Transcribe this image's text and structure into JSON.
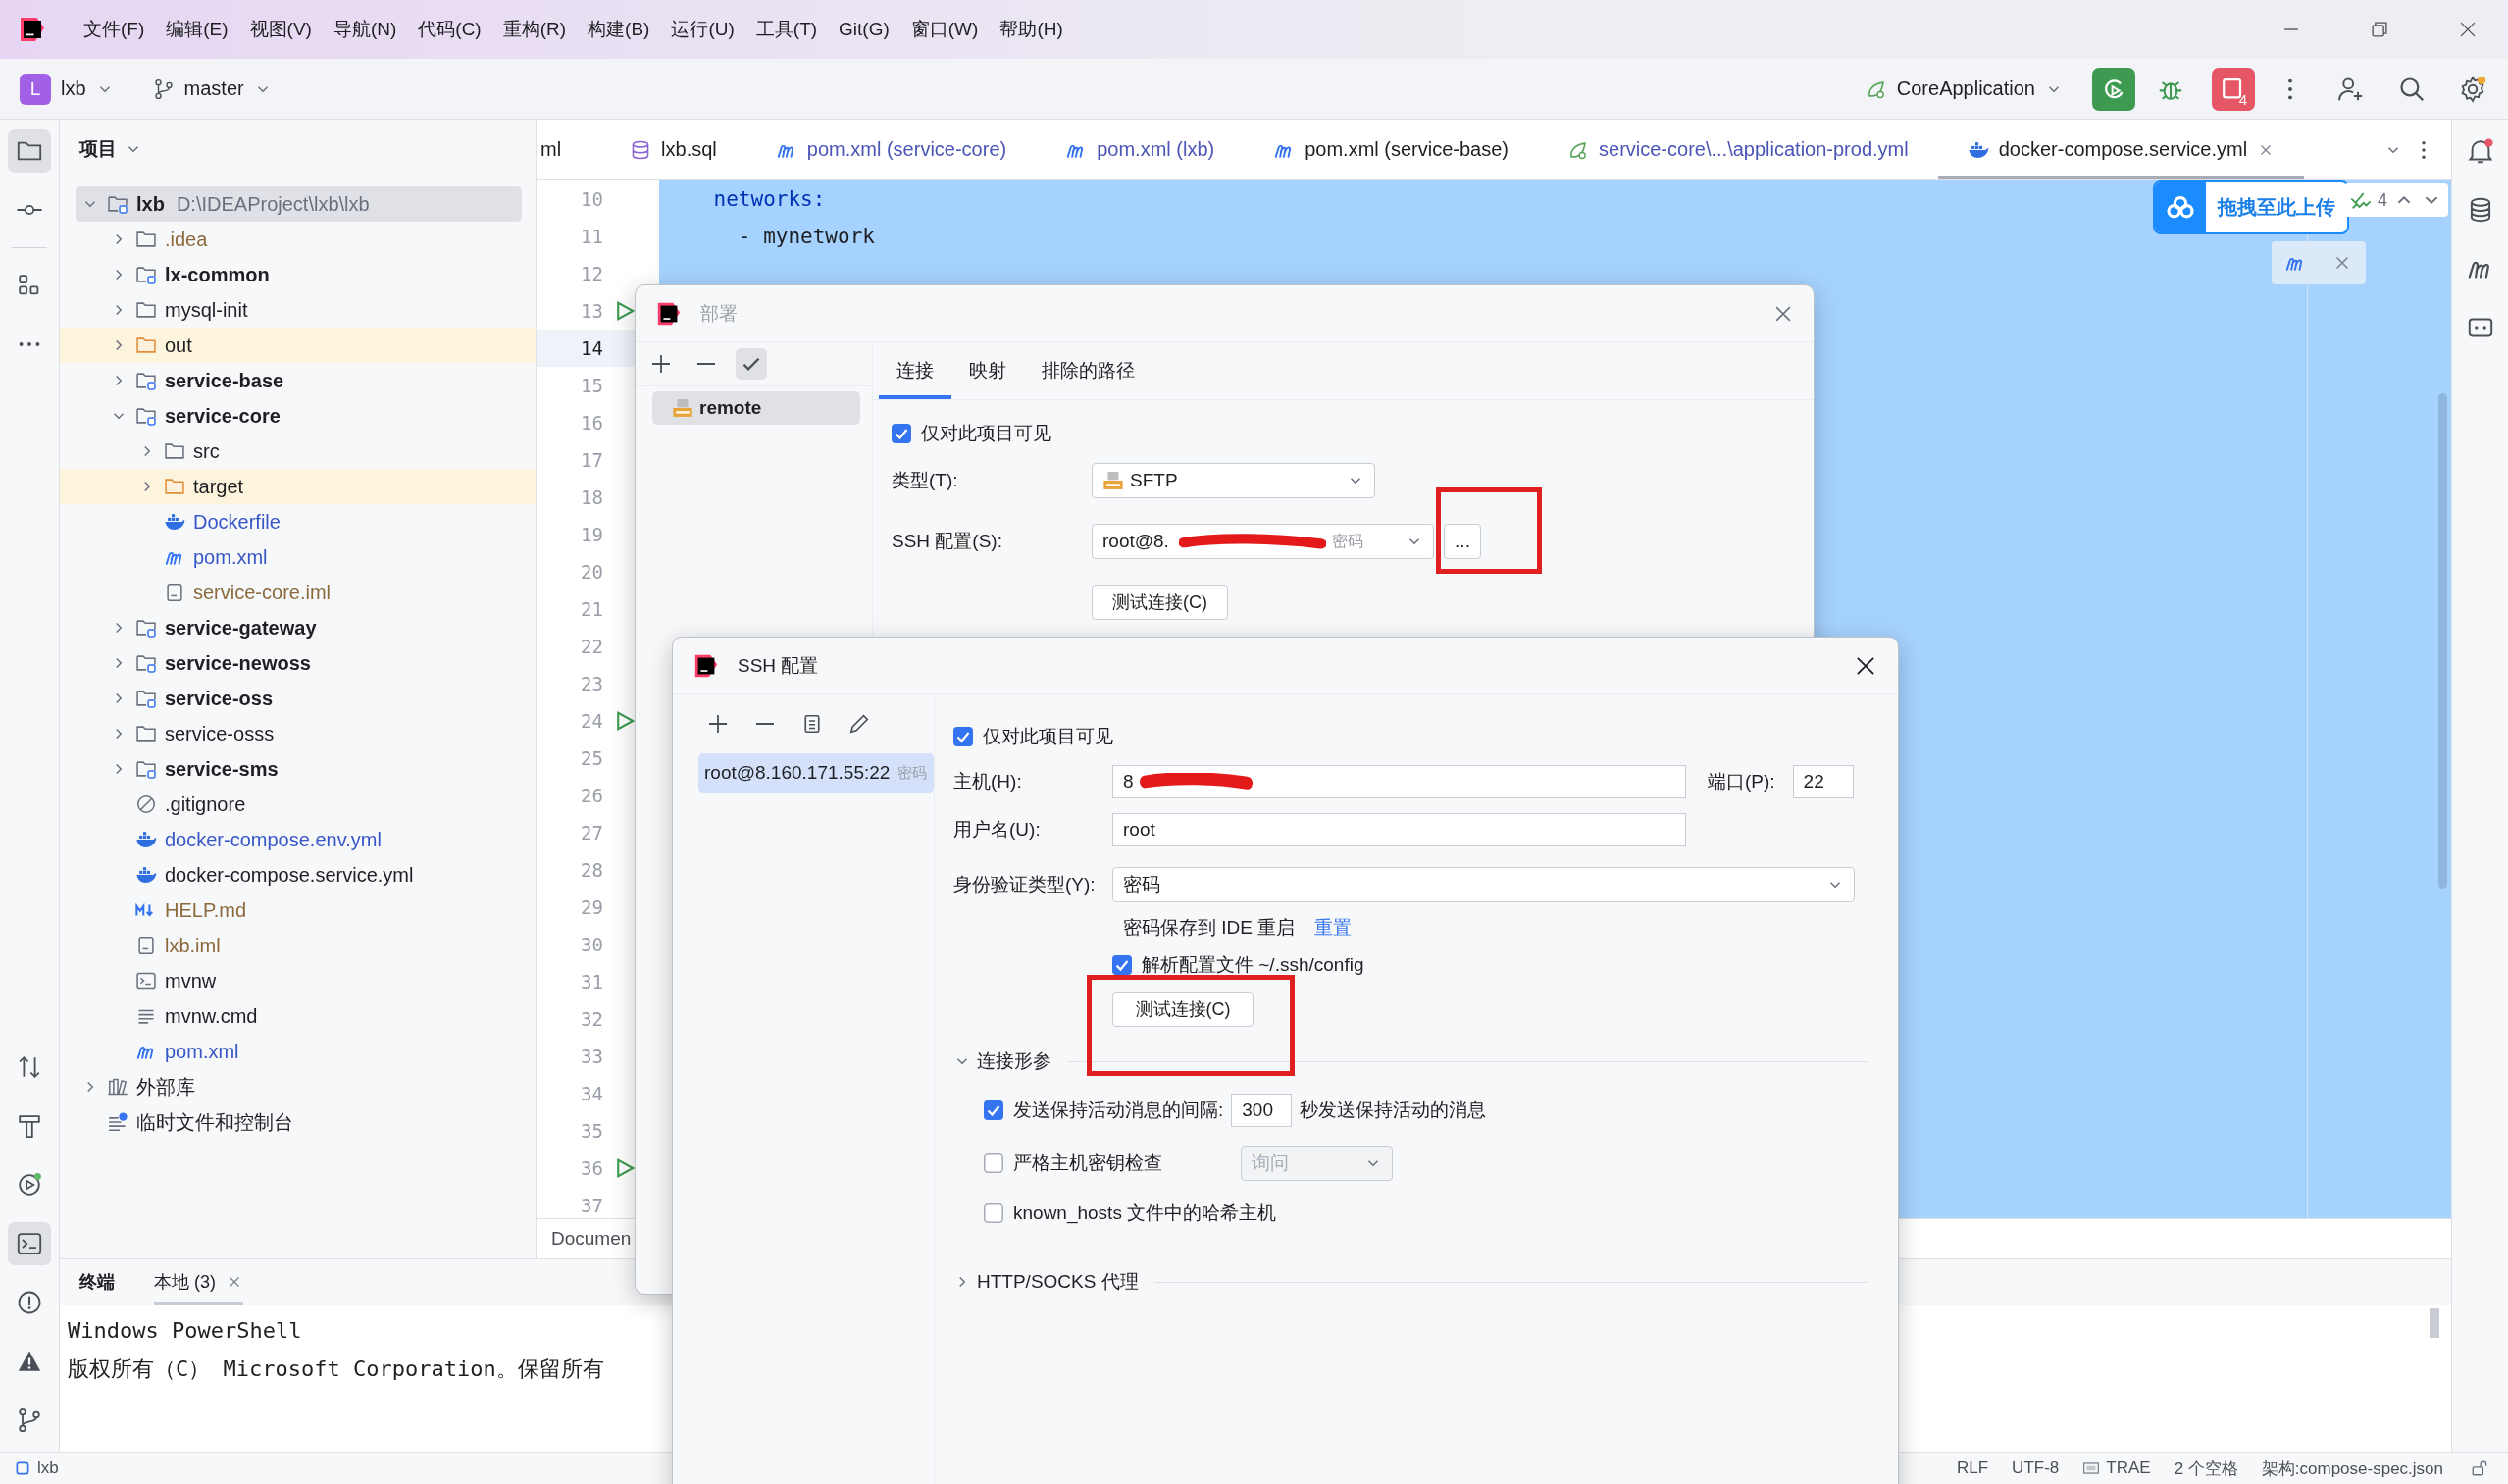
{
  "menu": [
    "文件(F)",
    "编辑(E)",
    "视图(V)",
    "导航(N)",
    "代码(C)",
    "重构(R)",
    "构建(B)",
    "运行(U)",
    "工具(T)",
    "Git(G)",
    "窗口(W)",
    "帮助(H)"
  ],
  "toolbar": {
    "project_initial": "L",
    "project": "lxb",
    "branch": "master",
    "run_config": "CoreApplication",
    "stop_count": "4",
    "settings_update": true
  },
  "left_tools": [
    {
      "kind": "project",
      "selected": true
    },
    {
      "kind": "commit",
      "selected": false
    },
    {
      "kind": "structure",
      "selected": false
    },
    {
      "kind": "more",
      "selected": false
    }
  ],
  "left_tools_bottom": [
    {
      "kind": "pull",
      "selected": false
    },
    {
      "kind": "build",
      "selected": false
    },
    {
      "kind": "services",
      "selected": false
    },
    {
      "kind": "terminal",
      "selected": true
    },
    {
      "kind": "problems",
      "selected": false
    },
    {
      "kind": "warning",
      "selected": false
    },
    {
      "kind": "git",
      "selected": false
    }
  ],
  "right_tools": [
    {
      "kind": "notifications",
      "unread": true
    },
    {
      "kind": "database",
      "unread": false
    },
    {
      "kind": "maven",
      "unread": false
    },
    {
      "kind": "ai",
      "unread": false
    }
  ],
  "project_panel": {
    "title": "项目",
    "tree": [
      {
        "label": "lxb",
        "path": "D:\\IDEAProject\\lxb\\lxb",
        "kind": "module",
        "color": "#1e1f22",
        "expanded": true,
        "selected": true,
        "children": [
          {
            "label": ".idea",
            "kind": "folder",
            "color": "#8c6a3c",
            "expanded": false,
            "selected": false
          },
          {
            "label": "lx-common",
            "kind": "module",
            "color": "#1e1f22",
            "expanded": false,
            "selected": false
          },
          {
            "label": "mysql-init",
            "kind": "folder",
            "color": "#1e1f22",
            "expanded": false,
            "selected": false
          },
          {
            "label": "out",
            "kind": "excluded",
            "color": "#1e1f22",
            "expanded": false,
            "selected": false
          },
          {
            "label": "service-base",
            "kind": "module",
            "color": "#1e1f22",
            "expanded": false,
            "selected": false
          },
          {
            "label": "service-core",
            "kind": "module",
            "color": "#1e1f22",
            "expanded": true,
            "selected": false,
            "children": [
              {
                "label": "src",
                "kind": "folder",
                "color": "#1e1f22",
                "expanded": false,
                "selected": false
              },
              {
                "label": "target",
                "kind": "excluded",
                "color": "#1e1f22",
                "expanded": false,
                "selected": false
              },
              {
                "label": "Dockerfile",
                "kind": "docker",
                "color": "#3857c6",
                "selected": false
              },
              {
                "label": "pom.xml",
                "kind": "maven",
                "color": "#3857c6",
                "selected": false
              },
              {
                "label": "service-core.iml",
                "kind": "iml",
                "color": "#8c6a3c",
                "selected": false
              }
            ]
          },
          {
            "label": "service-gateway",
            "kind": "module",
            "color": "#1e1f22",
            "expanded": false,
            "selected": false
          },
          {
            "label": "service-newoss",
            "kind": "module",
            "color": "#1e1f22",
            "expanded": false,
            "selected": false
          },
          {
            "label": "service-oss",
            "kind": "module",
            "color": "#1e1f22",
            "expanded": false,
            "selected": false
          },
          {
            "label": "service-osss",
            "kind": "folder",
            "color": "#1e1f22",
            "expanded": false,
            "selected": false
          },
          {
            "label": "service-sms",
            "kind": "module",
            "color": "#1e1f22",
            "expanded": false,
            "selected": false
          },
          {
            "label": ".gitignore",
            "kind": "gitignore",
            "color": "#1e1f22",
            "selected": false
          },
          {
            "label": "docker-compose.env.yml",
            "kind": "docker",
            "color": "#3857c6",
            "selected": false
          },
          {
            "label": "docker-compose.service.yml",
            "kind": "docker",
            "color": "#1e1f22",
            "selected": false
          },
          {
            "label": "HELP.md",
            "kind": "markdown",
            "color": "#8c6a3c",
            "selected": false
          },
          {
            "label": "lxb.iml",
            "kind": "iml",
            "color": "#8c6a3c",
            "selected": false
          },
          {
            "label": "mvnw",
            "kind": "script",
            "color": "#1e1f22",
            "selected": false
          },
          {
            "label": "mvnw.cmd",
            "kind": "text",
            "color": "#1e1f22",
            "selected": false
          },
          {
            "label": "pom.xml",
            "kind": "maven",
            "color": "#3857c6",
            "selected": false
          }
        ]
      },
      {
        "label": "外部库",
        "kind": "library",
        "color": "#1e1f22",
        "expanded": false,
        "selected": false
      },
      {
        "label": "临时文件和控制台",
        "kind": "scratch",
        "color": "#1e1f22",
        "selected": false
      }
    ]
  },
  "editor": {
    "tabs": [
      {
        "label": "ml",
        "kind": "plain",
        "color": "#1e1f22",
        "selected": false
      },
      {
        "label": "lxb.sql",
        "kind": "sql",
        "color": "#1e1f22",
        "selected": false
      },
      {
        "label": "pom.xml (service-core)",
        "kind": "maven",
        "color": "#4a55b5",
        "selected": false
      },
      {
        "label": "pom.xml (lxb)",
        "kind": "maven",
        "color": "#4a55b5",
        "selected": false
      },
      {
        "label": "pom.xml (service-base)",
        "kind": "maven",
        "color": "#1e1f22",
        "selected": false
      },
      {
        "label": "service-core\\...\\application-prod.yml",
        "kind": "spring",
        "color": "#4a55b5",
        "selected": false
      },
      {
        "label": "docker-compose.service.yml",
        "kind": "docker",
        "color": "#1e1f22",
        "selected": true
      }
    ],
    "lines": [
      {
        "number": "10",
        "code": "    networks:",
        "kind": "key",
        "run": false,
        "current": false
      },
      {
        "number": "11",
        "code": "      - mynetwork",
        "kind": "item",
        "run": false,
        "current": false
      },
      {
        "number": "12",
        "run": false,
        "current": false
      },
      {
        "number": "13",
        "run": true,
        "current": false
      },
      {
        "number": "14",
        "run": false,
        "current": true
      },
      {
        "number": "15",
        "run": false,
        "current": false
      },
      {
        "number": "16",
        "run": false,
        "current": false
      },
      {
        "number": "17",
        "run": false,
        "current": false
      },
      {
        "number": "18",
        "run": false,
        "current": false
      },
      {
        "number": "19",
        "run": false,
        "current": false
      },
      {
        "number": "20",
        "run": false,
        "current": false
      },
      {
        "number": "21",
        "run": false,
        "current": false
      },
      {
        "number": "22",
        "run": false,
        "current": false
      },
      {
        "number": "23",
        "run": false,
        "current": false
      },
      {
        "number": "24",
        "run": true,
        "current": false
      },
      {
        "number": "25",
        "run": false,
        "current": false
      },
      {
        "number": "26",
        "run": false,
        "current": false
      },
      {
        "number": "27",
        "run": false,
        "current": false
      },
      {
        "number": "28",
        "run": false,
        "current": false
      },
      {
        "number": "29",
        "run": false,
        "current": false
      },
      {
        "number": "30",
        "run": false,
        "current": false
      },
      {
        "number": "31",
        "run": false,
        "current": false
      },
      {
        "number": "32",
        "run": false,
        "current": false
      },
      {
        "number": "33",
        "run": false,
        "current": false
      },
      {
        "number": "34",
        "run": false,
        "current": false
      },
      {
        "number": "35",
        "run": false,
        "current": false
      },
      {
        "number": "36",
        "run": true,
        "current": false
      },
      {
        "number": "37",
        "run": false,
        "current": false
      }
    ],
    "upload_badge": "拖拽至此上传",
    "inspections": "4",
    "breadcrumb": "Documen"
  },
  "terminal": {
    "title": "终端",
    "tabs": [
      {
        "label": "本地 (3)",
        "selected": true
      }
    ],
    "lines": [
      "Windows PowerShell",
      "版权所有（C） Microsoft Corporation。保留所有"
    ]
  },
  "status_bar": {
    "project": "lxb",
    "items": [
      {
        "kind": "text",
        "label": "RLF"
      },
      {
        "kind": "text",
        "label": "UTF-8"
      },
      {
        "kind": "trae",
        "label": "TRAE"
      },
      {
        "kind": "text",
        "label": "2 个空格"
      },
      {
        "kind": "text",
        "label": "架构:compose-spec.json"
      }
    ]
  },
  "deploy_dialog": {
    "title": "部署",
    "default_on": true,
    "servers": [
      {
        "label": "remote",
        "selected": true
      }
    ],
    "tabs": [
      {
        "label": "连接",
        "selected": true
      },
      {
        "label": "映射",
        "selected": false
      },
      {
        "label": "排除的路径",
        "selected": false
      }
    ],
    "visible_only_project": {
      "label": "仅对此项目可见",
      "checked": true
    },
    "type": {
      "label": "类型(T):",
      "value": "SFTP"
    },
    "ssh_config": {
      "label": "SSH 配置(S):",
      "value": "root@8.",
      "auth": "密码",
      "browse": "..."
    },
    "test_button": "测试连接(C)"
  },
  "ssh_dialog": {
    "title": "SSH 配置",
    "configs": [
      {
        "label": "root@8.160.171.55:22",
        "auth": "密码",
        "selected": true
      }
    ],
    "visible_only_project": {
      "label": "仅对此项目可见",
      "checked": true
    },
    "host": {
      "label": "主机(H):",
      "value": "8"
    },
    "port": {
      "label": "端口(P):",
      "value": "22"
    },
    "username": {
      "label": "用户名(U):",
      "value": "root"
    },
    "auth_type": {
      "label": "身份验证类型(Y):",
      "value": "密码"
    },
    "password_note": "密码保存到 IDE 重启",
    "reset_link": "重置",
    "parse_config": {
      "label": "解析配置文件 ~/.ssh/config",
      "checked": true
    },
    "test_button": "测试连接(C)",
    "sections": [
      {
        "title": "连接形参",
        "expanded": true,
        "options": [
          {
            "kind": "interval",
            "label": "发送保持活动消息的间隔:",
            "checked": true,
            "value": "300",
            "suffix": "秒发送保持活动的消息"
          },
          {
            "kind": "select",
            "label": "严格主机密钥检查",
            "checked": false,
            "value": "询问",
            "disabled": true
          },
          {
            "kind": "plain",
            "label": "known_hosts 文件中的哈希主机",
            "checked": false
          }
        ]
      },
      {
        "title": "HTTP/SOCKS 代理",
        "expanded": false
      }
    ]
  }
}
